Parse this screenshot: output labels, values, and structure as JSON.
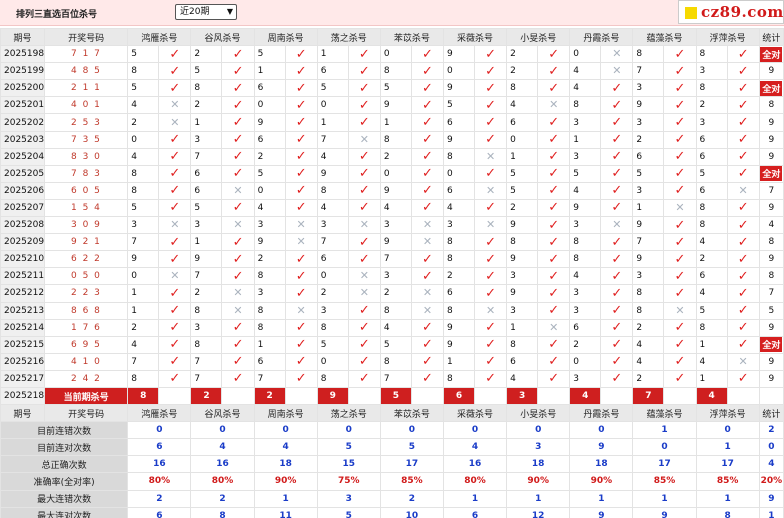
{
  "header": {
    "title": "排列三直选百位杀号",
    "period_select": "近20期",
    "logo": "cz89.com"
  },
  "table": {
    "col_period": "期号",
    "col_code": "开奖号码",
    "experts": [
      "鸿雁杀号",
      "谷风杀号",
      "周南杀号",
      "荡之杀号",
      "苯苡杀号",
      "采薇杀号",
      "小旻杀号",
      "丹霞杀号",
      "蕴藻杀号",
      "浮萍杀号"
    ],
    "col_stat": "统计",
    "rows": [
      {
        "period": "2025198",
        "code": "717",
        "kills": [
          5,
          2,
          5,
          1,
          0,
          9,
          2,
          0,
          8,
          8
        ],
        "marks": [
          1,
          1,
          1,
          1,
          1,
          1,
          1,
          0,
          1,
          1
        ],
        "stat": "全对"
      },
      {
        "period": "2025199",
        "code": "485",
        "kills": [
          8,
          5,
          1,
          6,
          8,
          0,
          2,
          4,
          7,
          3
        ],
        "marks": [
          1,
          1,
          1,
          1,
          1,
          1,
          1,
          0,
          1,
          1
        ],
        "stat": "9"
      },
      {
        "period": "2025200",
        "code": "211",
        "kills": [
          5,
          8,
          6,
          5,
          5,
          9,
          8,
          4,
          3,
          8
        ],
        "marks": [
          1,
          1,
          1,
          1,
          1,
          1,
          1,
          1,
          1,
          1
        ],
        "stat": "全对"
      },
      {
        "period": "2025201",
        "code": "401",
        "kills": [
          4,
          2,
          0,
          0,
          9,
          5,
          4,
          8,
          9,
          2
        ],
        "marks": [
          0,
          1,
          1,
          1,
          1,
          1,
          0,
          1,
          1,
          1
        ],
        "stat": "8"
      },
      {
        "period": "2025202",
        "code": "253",
        "kills": [
          2,
          1,
          9,
          1,
          1,
          6,
          6,
          3,
          3,
          3
        ],
        "marks": [
          0,
          1,
          1,
          1,
          1,
          1,
          1,
          1,
          1,
          1
        ],
        "stat": "9"
      },
      {
        "period": "2025203",
        "code": "735",
        "kills": [
          0,
          3,
          6,
          7,
          8,
          9,
          0,
          1,
          2,
          6
        ],
        "marks": [
          1,
          1,
          1,
          0,
          1,
          1,
          1,
          1,
          1,
          1
        ],
        "stat": "9"
      },
      {
        "period": "2025204",
        "code": "830",
        "kills": [
          4,
          7,
          2,
          4,
          2,
          8,
          1,
          3,
          6,
          6
        ],
        "marks": [
          1,
          1,
          1,
          1,
          1,
          0,
          1,
          1,
          1,
          1
        ],
        "stat": "9"
      },
      {
        "period": "2025205",
        "code": "783",
        "kills": [
          8,
          6,
          5,
          9,
          0,
          0,
          5,
          5,
          5,
          5
        ],
        "marks": [
          1,
          1,
          1,
          1,
          1,
          1,
          1,
          1,
          1,
          1
        ],
        "stat": "全对"
      },
      {
        "period": "2025206",
        "code": "605",
        "kills": [
          8,
          6,
          0,
          8,
          9,
          6,
          5,
          4,
          3,
          6
        ],
        "marks": [
          1,
          0,
          1,
          1,
          1,
          0,
          1,
          1,
          1,
          0
        ],
        "stat": "7"
      },
      {
        "period": "2025207",
        "code": "154",
        "kills": [
          5,
          5,
          4,
          4,
          4,
          4,
          2,
          9,
          1,
          8
        ],
        "marks": [
          1,
          1,
          1,
          1,
          1,
          1,
          1,
          1,
          0,
          1
        ],
        "stat": "9"
      },
      {
        "period": "2025208",
        "code": "309",
        "kills": [
          3,
          3,
          3,
          3,
          3,
          3,
          9,
          3,
          9,
          8
        ],
        "marks": [
          0,
          0,
          0,
          0,
          0,
          0,
          1,
          0,
          1,
          1
        ],
        "stat": "4"
      },
      {
        "period": "2025209",
        "code": "921",
        "kills": [
          7,
          1,
          9,
          7,
          9,
          8,
          8,
          8,
          7,
          4
        ],
        "marks": [
          1,
          1,
          0,
          1,
          0,
          1,
          1,
          1,
          1,
          1
        ],
        "stat": "8"
      },
      {
        "period": "2025210",
        "code": "622",
        "kills": [
          9,
          9,
          2,
          6,
          7,
          8,
          9,
          8,
          9,
          2
        ],
        "marks": [
          1,
          1,
          1,
          1,
          1,
          1,
          1,
          1,
          1,
          1
        ],
        "stat": "9"
      },
      {
        "period": "2025211",
        "code": "050",
        "kills": [
          0,
          7,
          8,
          0,
          3,
          2,
          3,
          4,
          3,
          6
        ],
        "marks": [
          0,
          1,
          1,
          0,
          1,
          1,
          1,
          1,
          1,
          1
        ],
        "stat": "8"
      },
      {
        "period": "2025212",
        "code": "223",
        "kills": [
          1,
          2,
          3,
          2,
          2,
          6,
          9,
          3,
          8,
          4
        ],
        "marks": [
          1,
          0,
          1,
          0,
          0,
          1,
          1,
          1,
          1,
          1
        ],
        "stat": "7"
      },
      {
        "period": "2025213",
        "code": "868",
        "kills": [
          1,
          8,
          8,
          3,
          8,
          8,
          3,
          3,
          8,
          5
        ],
        "marks": [
          1,
          0,
          0,
          1,
          0,
          0,
          1,
          1,
          0,
          1
        ],
        "stat": "5"
      },
      {
        "period": "2025214",
        "code": "176",
        "kills": [
          2,
          3,
          8,
          8,
          4,
          9,
          1,
          6,
          2,
          8
        ],
        "marks": [
          1,
          1,
          1,
          1,
          1,
          1,
          0,
          1,
          1,
          1
        ],
        "stat": "9"
      },
      {
        "period": "2025215",
        "code": "695",
        "kills": [
          4,
          8,
          1,
          5,
          5,
          9,
          8,
          2,
          4,
          1
        ],
        "marks": [
          1,
          1,
          1,
          1,
          1,
          1,
          1,
          1,
          1,
          1
        ],
        "stat": "全对"
      },
      {
        "period": "2025216",
        "code": "410",
        "kills": [
          7,
          7,
          6,
          0,
          8,
          1,
          6,
          0,
          4,
          4
        ],
        "marks": [
          1,
          1,
          1,
          1,
          1,
          1,
          1,
          1,
          1,
          0
        ],
        "stat": "9"
      },
      {
        "period": "2025217",
        "code": "242",
        "kills": [
          8,
          7,
          7,
          8,
          7,
          8,
          4,
          3,
          2,
          1
        ],
        "marks": [
          1,
          1,
          1,
          1,
          1,
          1,
          1,
          1,
          1,
          1
        ],
        "stat": "9"
      }
    ],
    "current": {
      "period": "2025218",
      "label": "当前期杀号",
      "kills": [
        "8",
        "2",
        "2",
        "9",
        "5",
        "6",
        "3",
        "4",
        "7",
        "4"
      ]
    }
  },
  "summary": {
    "header_period": "期号",
    "header_code": "开奖号码",
    "rows": [
      {
        "label": "目前连错次数",
        "values": [
          "0",
          "0",
          "0",
          "0",
          "0",
          "0",
          "0",
          "0",
          "1",
          "0",
          "2"
        ]
      },
      {
        "label": "目前连对次数",
        "values": [
          "6",
          "4",
          "4",
          "5",
          "5",
          "4",
          "3",
          "9",
          "0",
          "1",
          "0"
        ]
      },
      {
        "label": "总正确次数",
        "values": [
          "16",
          "16",
          "18",
          "15",
          "17",
          "16",
          "18",
          "18",
          "17",
          "17",
          "4"
        ]
      },
      {
        "label": "准确率(全对率)",
        "values": [
          "80%",
          "80%",
          "90%",
          "75%",
          "85%",
          "80%",
          "90%",
          "90%",
          "85%",
          "85%",
          "20%"
        ],
        "red": true
      },
      {
        "label": "最大连错次数",
        "values": [
          "2",
          "2",
          "1",
          "3",
          "2",
          "1",
          "1",
          "1",
          "1",
          "1",
          "9"
        ]
      },
      {
        "label": "最大连对次数",
        "values": [
          "6",
          "8",
          "11",
          "5",
          "10",
          "6",
          "12",
          "9",
          "9",
          "8",
          "1"
        ]
      }
    ]
  },
  "icons": {
    "correct": "check-icon",
    "wrong": "cross-icon"
  },
  "colors": {
    "accent_red": "#cf1f1f",
    "check_red": "#e02020",
    "blue_value": "#1a3cc8",
    "cross_gray": "#aab3be"
  }
}
